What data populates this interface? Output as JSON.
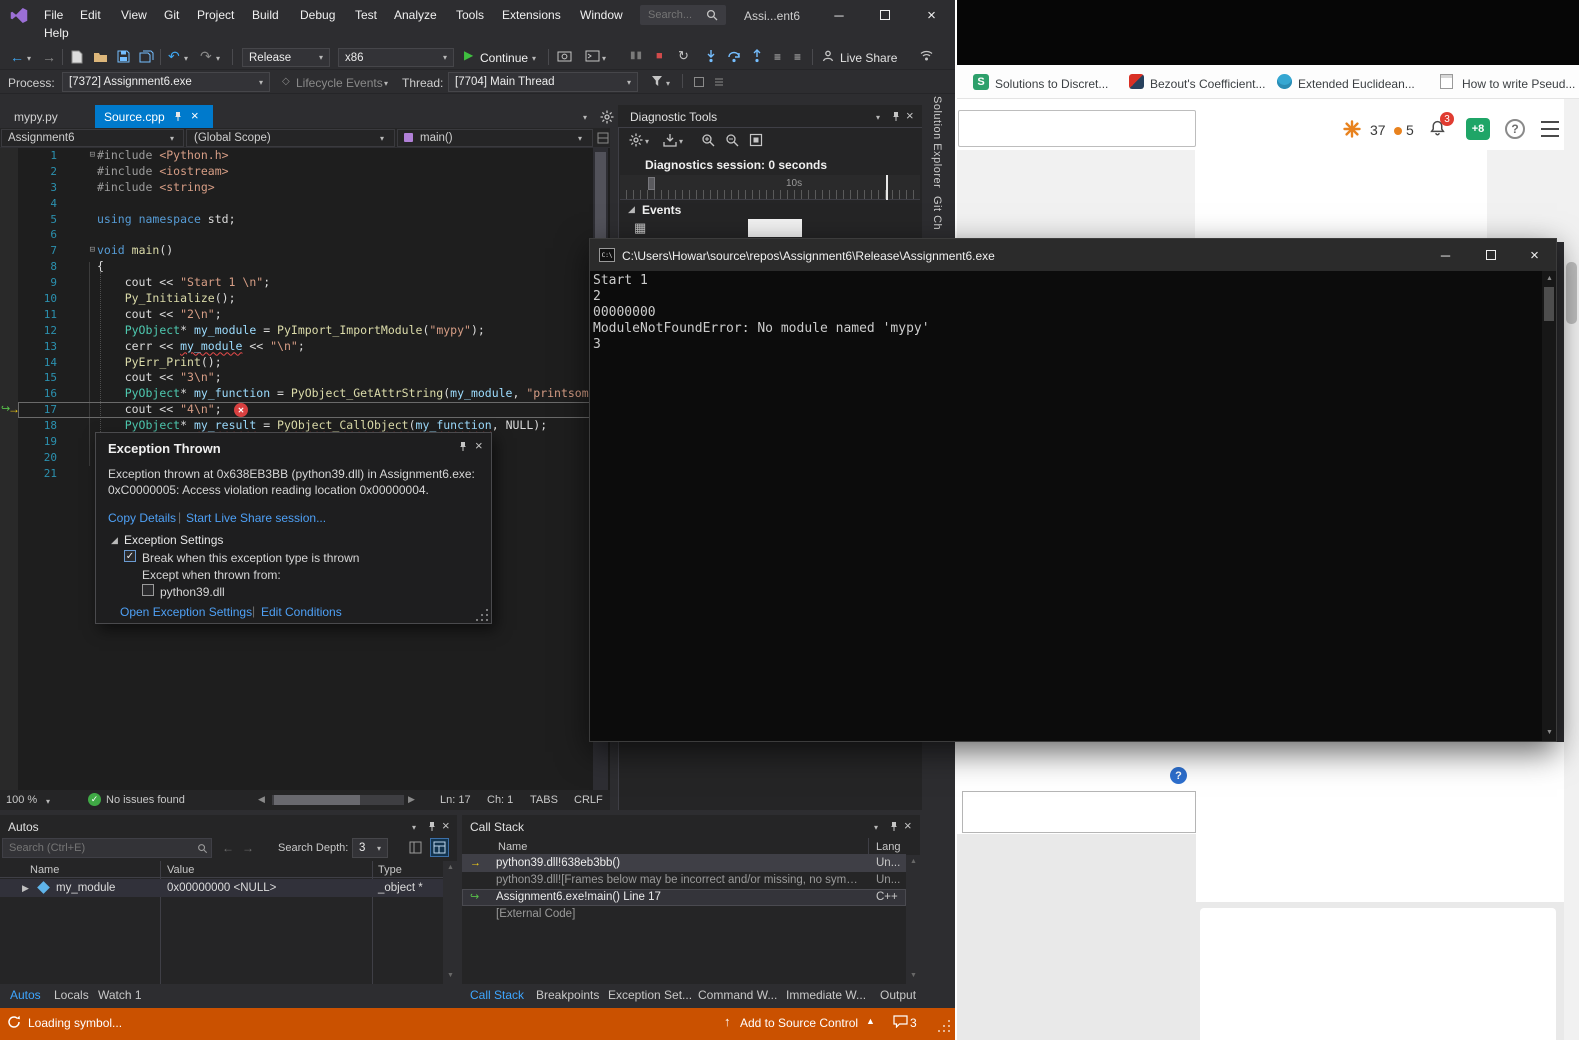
{
  "vs": {
    "titlebar": {
      "menu": [
        "File",
        "Edit",
        "View",
        "Git",
        "Project",
        "Build",
        "Debug",
        "Test",
        "Analyze",
        "Tools",
        "Extensions",
        "Window"
      ],
      "help": "Help",
      "search_placeholder": "Search...",
      "window_title": "Assi...ent6"
    },
    "toolbar": {
      "config": "Release",
      "platform": "x86",
      "continue_label": "Continue",
      "live_share": "Live Share"
    },
    "debugbar": {
      "process_label": "Process:",
      "process_value": "[7372] Assignment6.exe",
      "lifecycle": "Lifecycle Events",
      "thread_label": "Thread:",
      "thread_value": "[7704] Main Thread"
    },
    "tabs": {
      "inactive": "mypy.py",
      "active": "Source.cpp"
    },
    "navbar": {
      "project": "Assignment6",
      "scope": "(Global Scope)",
      "member": "main()"
    },
    "side_tabs": {
      "solution": "Solution Explorer",
      "git": "Git Ch"
    },
    "editor": {
      "lines": [
        {
          "n": 1,
          "fold": true,
          "seg": [
            {
              "t": "#include ",
              "c": "pre"
            },
            {
              "t": "<Python.h>",
              "c": "str"
            }
          ]
        },
        {
          "n": 2,
          "seg": [
            {
              "t": "#include ",
              "c": "pre"
            },
            {
              "t": "<iostream>",
              "c": "str"
            }
          ]
        },
        {
          "n": 3,
          "seg": [
            {
              "t": "#include ",
              "c": "pre"
            },
            {
              "t": "<string>",
              "c": "str"
            }
          ]
        },
        {
          "n": 4,
          "seg": []
        },
        {
          "n": 5,
          "seg": [
            {
              "t": "using",
              "c": "kw"
            },
            {
              "t": " ",
              "c": "d"
            },
            {
              "t": "namespace",
              "c": "kw"
            },
            {
              "t": " std;",
              "c": "d"
            }
          ]
        },
        {
          "n": 6,
          "seg": []
        },
        {
          "n": 7,
          "fold": true,
          "seg": [
            {
              "t": "void",
              "c": "kw"
            },
            {
              "t": " ",
              "c": "d"
            },
            {
              "t": "main",
              "c": "fn"
            },
            {
              "t": "()",
              "c": "d"
            }
          ]
        },
        {
          "n": 8,
          "seg": [
            {
              "t": "{",
              "c": "d"
            }
          ]
        },
        {
          "n": 9,
          "seg": [
            {
              "t": "    cout << ",
              "c": "d"
            },
            {
              "t": "\"Start 1 \\n\"",
              "c": "str"
            },
            {
              "t": ";",
              "c": "d"
            }
          ]
        },
        {
          "n": 10,
          "seg": [
            {
              "t": "    ",
              "c": "d"
            },
            {
              "t": "Py_Initialize",
              "c": "fn"
            },
            {
              "t": "();",
              "c": "d"
            }
          ]
        },
        {
          "n": 11,
          "seg": [
            {
              "t": "    cout << ",
              "c": "d"
            },
            {
              "t": "\"2\\n\"",
              "c": "str"
            },
            {
              "t": ";",
              "c": "d"
            }
          ]
        },
        {
          "n": 12,
          "seg": [
            {
              "t": "    ",
              "c": "d"
            },
            {
              "t": "PyObject",
              "c": "type"
            },
            {
              "t": "* ",
              "c": "d"
            },
            {
              "t": "my_module",
              "c": "var"
            },
            {
              "t": " = ",
              "c": "d"
            },
            {
              "t": "PyImport_ImportModule",
              "c": "fn"
            },
            {
              "t": "(",
              "c": "d"
            },
            {
              "t": "\"mypy\"",
              "c": "str"
            },
            {
              "t": ");",
              "c": "d"
            }
          ]
        },
        {
          "n": 13,
          "seg": [
            {
              "t": "    cerr << ",
              "c": "d"
            },
            {
              "t": "my_module",
              "c": "var sq"
            },
            {
              "t": " << ",
              "c": "d"
            },
            {
              "t": "\"\\n\"",
              "c": "str"
            },
            {
              "t": ";",
              "c": "d"
            }
          ]
        },
        {
          "n": 14,
          "seg": [
            {
              "t": "    ",
              "c": "d"
            },
            {
              "t": "PyErr_Print",
              "c": "fn"
            },
            {
              "t": "();",
              "c": "d"
            }
          ]
        },
        {
          "n": 15,
          "seg": [
            {
              "t": "    cout << ",
              "c": "d"
            },
            {
              "t": "\"3\\n\"",
              "c": "str"
            },
            {
              "t": ";",
              "c": "d"
            }
          ]
        },
        {
          "n": 16,
          "seg": [
            {
              "t": "    ",
              "c": "d"
            },
            {
              "t": "PyObject",
              "c": "type"
            },
            {
              "t": "* ",
              "c": "d"
            },
            {
              "t": "my_function",
              "c": "var"
            },
            {
              "t": " = ",
              "c": "d"
            },
            {
              "t": "PyObject_GetAttrString",
              "c": "fn"
            },
            {
              "t": "(",
              "c": "d"
            },
            {
              "t": "my_module",
              "c": "var"
            },
            {
              "t": ", ",
              "c": "d"
            },
            {
              "t": "\"printsom",
              "c": "str"
            }
          ]
        },
        {
          "n": 17,
          "cur": true,
          "seg": [
            {
              "t": "    cout << ",
              "c": "d"
            },
            {
              "t": "\"4\\n\"",
              "c": "str"
            },
            {
              "t": ";",
              "c": "d"
            }
          ]
        },
        {
          "n": 18,
          "seg": [
            {
              "t": "    ",
              "c": "d"
            },
            {
              "t": "PyObject",
              "c": "type"
            },
            {
              "t": "* ",
              "c": "d"
            },
            {
              "t": "my_result",
              "c": "var sq"
            },
            {
              "t": " = ",
              "c": "d"
            },
            {
              "t": "PyObject_CallObject",
              "c": "fn sq"
            },
            {
              "t": "(",
              "c": "d"
            },
            {
              "t": "my_function",
              "c": "var sq"
            },
            {
              "t": ", ",
              "c": "d"
            },
            {
              "t": "NULL);",
              "c": "d"
            }
          ]
        },
        {
          "n": 19,
          "seg": []
        },
        {
          "n": 20,
          "seg": []
        },
        {
          "n": 21,
          "seg": []
        }
      ]
    },
    "statusline": {
      "zoom": "100 %",
      "issues": "No issues found",
      "ln": "Ln: 17",
      "ch": "Ch: 1",
      "tabs": "TABS",
      "eol": "CRLF"
    },
    "diagnostics": {
      "title": "Diagnostic Tools",
      "session": "Diagnostics session: 0 seconds",
      "tick": "10s",
      "events_label": "Events"
    },
    "exception": {
      "title": "Exception Thrown",
      "line1": "Exception thrown at 0x638EB3BB (python39.dll) in Assignment6.exe:",
      "line2": "0xC0000005: Access violation reading location 0x00000004.",
      "copy_details": "Copy Details",
      "live_share": "Start Live Share session...",
      "settings_label": "Exception Settings",
      "break_label": "Break when this exception type is thrown",
      "except_label": "Except when thrown from:",
      "module": "python39.dll",
      "open_settings": "Open Exception Settings",
      "edit_conditions": "Edit Conditions"
    },
    "autos": {
      "title": "Autos",
      "search_placeholder": "Search (Ctrl+E)",
      "depth_label": "Search Depth:",
      "depth_value": "3",
      "columns": [
        "Name",
        "Value",
        "Type"
      ],
      "row": {
        "name": "my_module",
        "value": "0x00000000 <NULL>",
        "type": "_object *"
      },
      "tabs": [
        "Autos",
        "Locals",
        "Watch 1"
      ]
    },
    "callstack": {
      "title": "Call Stack",
      "columns": [
        "Name",
        "Lang"
      ],
      "rows": [
        {
          "name": "python39.dll!638eb3bb()",
          "lang": "Un..."
        },
        {
          "name": "python39.dll![Frames below may be incorrect and/or missing, no symbol...",
          "lang": "Un..."
        },
        {
          "name": "Assignment6.exe!main() Line 17",
          "lang": "C++"
        },
        {
          "name": "[External Code]",
          "lang": ""
        }
      ],
      "tabs": [
        "Call Stack",
        "Breakpoints",
        "Exception Set...",
        "Command W...",
        "Immediate W...",
        "Output"
      ]
    },
    "statusbar": {
      "message": "Loading symbol...",
      "source_control": "Add to Source Control",
      "feedback_count": "3"
    }
  },
  "console": {
    "title": "C:\\Users\\Howar\\source\\repos\\Assignment6\\Release\\Assignment6.exe",
    "lines": [
      "Start 1",
      "2",
      "00000000",
      "ModuleNotFoundError: No module named 'mypy'",
      "3"
    ]
  },
  "browser": {
    "bookmarks": [
      {
        "label": "Solutions to Discret..."
      },
      {
        "label": "Bezout's Coefficient..."
      },
      {
        "label": "Extended Euclidean..."
      },
      {
        "label": "How to write Pseud..."
      }
    ],
    "points": "37",
    "points_extra": "5",
    "bell_badge": "3",
    "avatar_badge": "+8",
    "help_q": "?",
    "input_help": "?"
  }
}
